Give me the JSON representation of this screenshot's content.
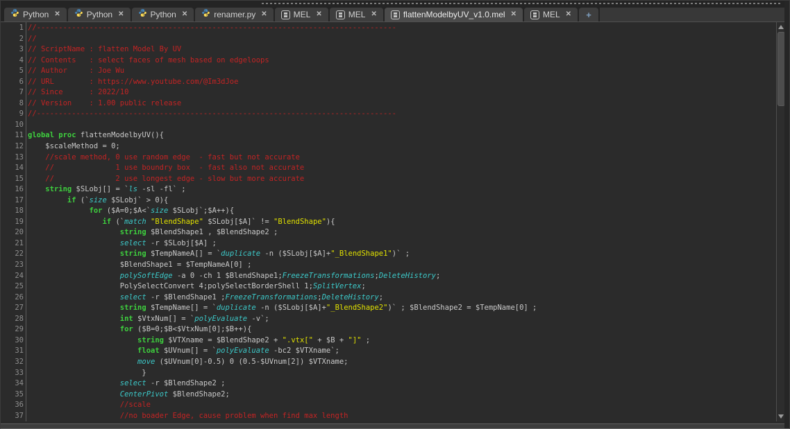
{
  "tab_bar": {
    "tabs": [
      {
        "label": "Python",
        "icon": "python",
        "active": false
      },
      {
        "label": "Python",
        "icon": "python",
        "active": false
      },
      {
        "label": "Python",
        "icon": "python",
        "active": false
      },
      {
        "label": "renamer.py",
        "icon": "python",
        "active": false
      },
      {
        "label": "MEL",
        "icon": "mel",
        "active": false
      },
      {
        "label": "MEL",
        "icon": "mel",
        "active": false
      },
      {
        "label": "flattenModelbyUV_v1.0.mel",
        "icon": "mel",
        "active": true
      },
      {
        "label": "MEL",
        "icon": "mel",
        "active": false
      }
    ],
    "new_tab_label": "+",
    "close_glyph": "✕"
  },
  "palette": {
    "editor_bg": "#2b2b2b",
    "tab_inactive_bg": "#3e3e3e",
    "tab_active_bg": "#4b4b4b",
    "comment": "#c32424",
    "keyword": "#3ecf3e",
    "command": "#3cc9c9",
    "string": "#e0e000",
    "default": "#c9c9c9",
    "line_number": "#8f8f8f",
    "python_icon_blue": "#4584b6",
    "python_icon_yellow": "#ffde57"
  },
  "editor": {
    "language": "MEL",
    "lines": [
      {
        "n": 1,
        "segs": [
          [
            "c",
            "//----------------------------------------------------------------------------------"
          ]
        ]
      },
      {
        "n": 2,
        "segs": [
          [
            "c",
            "//"
          ]
        ]
      },
      {
        "n": 3,
        "segs": [
          [
            "c",
            "// ScriptName : flatten Model By UV"
          ]
        ]
      },
      {
        "n": 4,
        "segs": [
          [
            "c",
            "// Contents   : select faces of mesh based on edgeloops"
          ]
        ]
      },
      {
        "n": 5,
        "segs": [
          [
            "c",
            "// Author     : Joe Wu"
          ]
        ]
      },
      {
        "n": 6,
        "segs": [
          [
            "c",
            "// URL        : https://www.youtube.com/@Im3dJoe"
          ]
        ]
      },
      {
        "n": 7,
        "segs": [
          [
            "c",
            "// Since      : 2022/10"
          ]
        ]
      },
      {
        "n": 8,
        "segs": [
          [
            "c",
            "// Version    : 1.00 public release"
          ]
        ]
      },
      {
        "n": 9,
        "segs": [
          [
            "c",
            "//----------------------------------------------------------------------------------"
          ]
        ]
      },
      {
        "n": 10,
        "segs": []
      },
      {
        "n": 11,
        "segs": [
          [
            "k",
            "global proc"
          ],
          [
            "d",
            " flattenModelbyUV(){"
          ]
        ]
      },
      {
        "n": 12,
        "segs": [
          [
            "d",
            "    $scaleMethod = 0;"
          ]
        ]
      },
      {
        "n": 13,
        "segs": [
          [
            "c",
            "    //scale method, 0 use random edge  - fast but not accurate"
          ]
        ]
      },
      {
        "n": 14,
        "segs": [
          [
            "c",
            "    //              1 use boundry box  - fast also not accurate"
          ]
        ]
      },
      {
        "n": 15,
        "segs": [
          [
            "c",
            "    //              2 use longest edge - slow but more accurate"
          ]
        ]
      },
      {
        "n": 16,
        "segs": [
          [
            "d",
            "    "
          ],
          [
            "k",
            "string"
          ],
          [
            "d",
            " $SLobj[] = `"
          ],
          [
            "m",
            "ls"
          ],
          [
            "d",
            " -sl -fl` ;"
          ]
        ]
      },
      {
        "n": 17,
        "segs": [
          [
            "d",
            "         "
          ],
          [
            "k",
            "if"
          ],
          [
            "d",
            " (`"
          ],
          [
            "m",
            "size"
          ],
          [
            "d",
            " $SLobj` > 0){"
          ]
        ]
      },
      {
        "n": 18,
        "segs": [
          [
            "d",
            "              "
          ],
          [
            "k",
            "for"
          ],
          [
            "d",
            " ($A=0;$A<`"
          ],
          [
            "m",
            "size"
          ],
          [
            "d",
            " $SLobj`;$A++){"
          ]
        ]
      },
      {
        "n": 19,
        "segs": [
          [
            "d",
            "                 "
          ],
          [
            "k",
            "if"
          ],
          [
            "d",
            " (`"
          ],
          [
            "m",
            "match"
          ],
          [
            "d",
            " "
          ],
          [
            "s",
            "\"BlendShape\""
          ],
          [
            "d",
            " $SLobj[$A]` != "
          ],
          [
            "s",
            "\"BlendShape\""
          ],
          [
            "d",
            "){"
          ]
        ]
      },
      {
        "n": 20,
        "segs": [
          [
            "d",
            "                     "
          ],
          [
            "k",
            "string"
          ],
          [
            "d",
            " $BlendShape1 , $BlendShape2 ;"
          ]
        ]
      },
      {
        "n": 21,
        "segs": [
          [
            "d",
            "                     "
          ],
          [
            "m",
            "select"
          ],
          [
            "d",
            " -r $SLobj[$A] ;"
          ]
        ]
      },
      {
        "n": 22,
        "segs": [
          [
            "d",
            "                     "
          ],
          [
            "k",
            "string"
          ],
          [
            "d",
            " $TempNameA[] = `"
          ],
          [
            "m",
            "duplicate"
          ],
          [
            "d",
            " -n ($SLobj[$A]+"
          ],
          [
            "s",
            "\"_BlendShape1\""
          ],
          [
            "d",
            ")` ;"
          ]
        ]
      },
      {
        "n": 23,
        "segs": [
          [
            "d",
            "                     $BlendShape1 = $TempNameA[0] ;"
          ]
        ]
      },
      {
        "n": 24,
        "segs": [
          [
            "d",
            "                     "
          ],
          [
            "m",
            "polySoftEdge"
          ],
          [
            "d",
            " -a 0 -ch 1 $BlendShape1;"
          ],
          [
            "m",
            "FreezeTransformations"
          ],
          [
            "d",
            ";"
          ],
          [
            "m",
            "DeleteHistory"
          ],
          [
            "d",
            ";"
          ]
        ]
      },
      {
        "n": 25,
        "segs": [
          [
            "d",
            "                     PolySelectConvert 4;polySelectBorderShell 1;"
          ],
          [
            "m",
            "SplitVertex"
          ],
          [
            "d",
            ";"
          ]
        ]
      },
      {
        "n": 26,
        "segs": [
          [
            "d",
            "                     "
          ],
          [
            "m",
            "select"
          ],
          [
            "d",
            " -r $BlendShape1 ;"
          ],
          [
            "m",
            "FreezeTransformations"
          ],
          [
            "d",
            ";"
          ],
          [
            "m",
            "DeleteHistory"
          ],
          [
            "d",
            ";"
          ]
        ]
      },
      {
        "n": 27,
        "segs": [
          [
            "d",
            "                     "
          ],
          [
            "k",
            "string"
          ],
          [
            "d",
            " $TempName[] = `"
          ],
          [
            "m",
            "duplicate"
          ],
          [
            "d",
            " -n ($SLobj[$A]+"
          ],
          [
            "s",
            "\"_BlendShape2\""
          ],
          [
            "d",
            ")` ; $BlendShape2 = $TempName[0] ;"
          ]
        ]
      },
      {
        "n": 28,
        "segs": [
          [
            "d",
            "                     "
          ],
          [
            "k",
            "int"
          ],
          [
            "d",
            " $VtxNum[] = `"
          ],
          [
            "m",
            "polyEvaluate"
          ],
          [
            "d",
            " -v`;"
          ]
        ]
      },
      {
        "n": 29,
        "segs": [
          [
            "d",
            "                     "
          ],
          [
            "k",
            "for"
          ],
          [
            "d",
            " ($B=0;$B<$VtxNum[0];$B++){"
          ]
        ]
      },
      {
        "n": 30,
        "segs": [
          [
            "d",
            "                         "
          ],
          [
            "k",
            "string"
          ],
          [
            "d",
            " $VTXname = $BlendShape2 + "
          ],
          [
            "s",
            "\".vtx[\""
          ],
          [
            "d",
            " + $B + "
          ],
          [
            "s",
            "\"]\""
          ],
          [
            "d",
            " ;"
          ]
        ]
      },
      {
        "n": 31,
        "segs": [
          [
            "d",
            "                         "
          ],
          [
            "k",
            "float"
          ],
          [
            "d",
            " $UVnum[] = `"
          ],
          [
            "m",
            "polyEvaluate"
          ],
          [
            "d",
            " -bc2 $VTXname`;"
          ]
        ]
      },
      {
        "n": 32,
        "segs": [
          [
            "d",
            "                         "
          ],
          [
            "m",
            "move"
          ],
          [
            "d",
            " ($UVnum[0]-0.5) 0 (0.5-$UVnum[2]) $VTXname;"
          ]
        ]
      },
      {
        "n": 33,
        "segs": [
          [
            "d",
            "                          }"
          ]
        ]
      },
      {
        "n": 34,
        "segs": [
          [
            "d",
            "                     "
          ],
          [
            "m",
            "select"
          ],
          [
            "d",
            " -r $BlendShape2 ;"
          ]
        ]
      },
      {
        "n": 35,
        "segs": [
          [
            "d",
            "                     "
          ],
          [
            "m",
            "CenterPivot"
          ],
          [
            "d",
            " $BlendShape2;"
          ]
        ]
      },
      {
        "n": 36,
        "segs": [
          [
            "c",
            "                     //scale"
          ]
        ]
      },
      {
        "n": 37,
        "segs": [
          [
            "c",
            "                     //no boader Edge, cause problem when find max length"
          ]
        ]
      }
    ]
  }
}
